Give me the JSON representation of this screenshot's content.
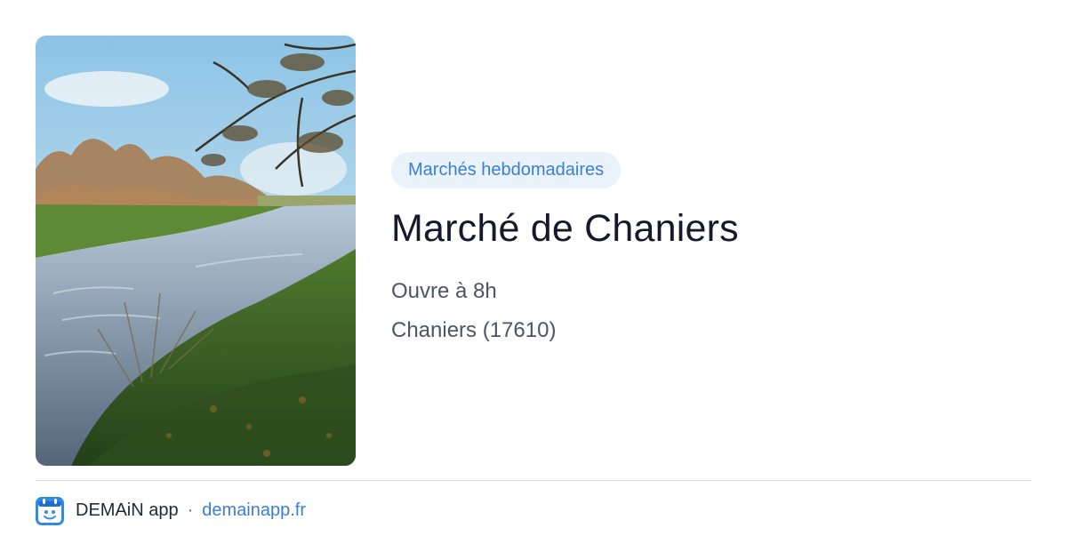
{
  "card": {
    "category": "Marchés hebdomadaires",
    "title": "Marché de Chaniers",
    "hours": "Ouvre à 8h",
    "location": "Chaniers (17610)",
    "image_subject": "landscape-photo"
  },
  "footer": {
    "app_name": "DEMAiN app",
    "separator": "·",
    "url": "demainapp.fr",
    "logo_icon": "demain-logo-icon"
  },
  "colors": {
    "accent": "#3b7fd4",
    "category_bg": "#eaf2fc",
    "title": "#15192b",
    "meta": "#4b5563",
    "divider": "#d7dfe6"
  }
}
